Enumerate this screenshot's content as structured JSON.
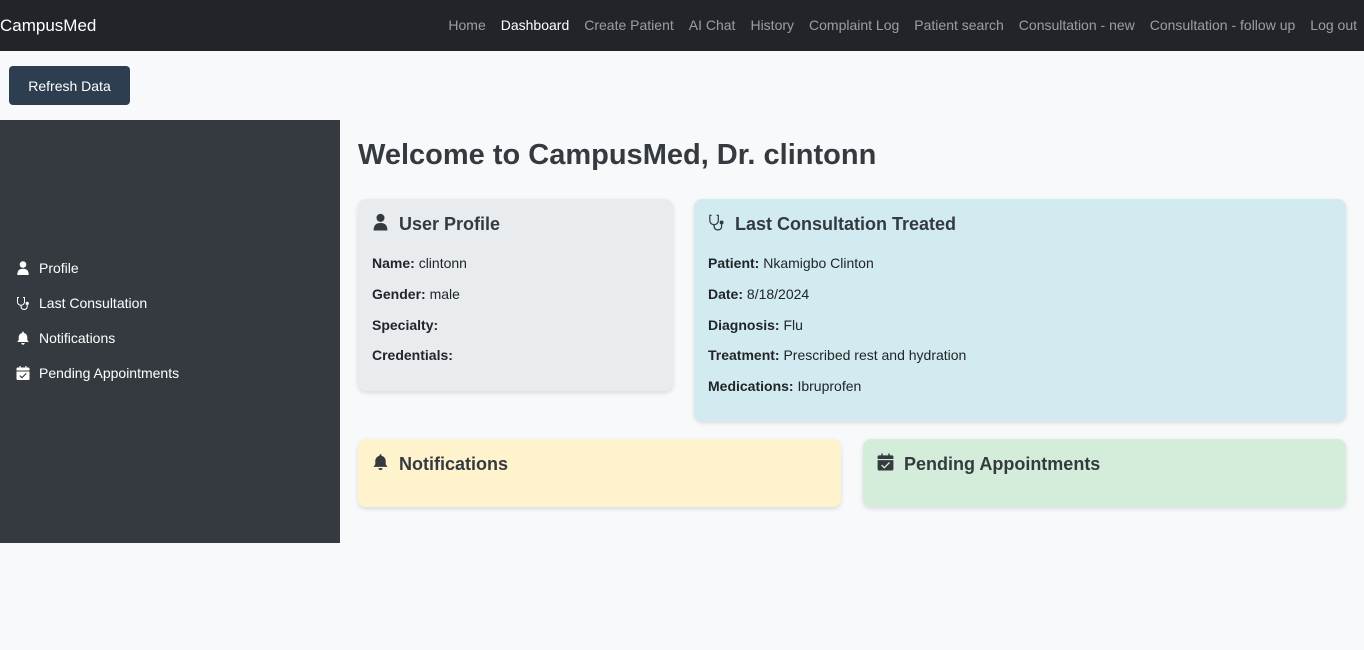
{
  "nav": {
    "brand": "CampusMed",
    "links": [
      "Home",
      "Dashboard",
      "Create Patient",
      "AI Chat",
      "History",
      "Complaint Log",
      "Patient search",
      "Consultation - new",
      "Consultation - follow up",
      "Log out"
    ]
  },
  "toolbar": {
    "refresh_label": "Refresh Data"
  },
  "sidebar": {
    "items": [
      {
        "label": "Profile",
        "icon": "user-icon"
      },
      {
        "label": "Last Consultation",
        "icon": "stethoscope-icon"
      },
      {
        "label": "Notifications",
        "icon": "bell-icon"
      },
      {
        "label": "Pending Appointments",
        "icon": "calendar-check-icon"
      }
    ]
  },
  "main": {
    "welcome": "Welcome to CampusMed, Dr. clintonn",
    "profile": {
      "title": "User Profile",
      "name_label": "Name:",
      "name": "clintonn",
      "gender_label": "Gender:",
      "gender": "male",
      "specialty_label": "Specialty:",
      "specialty": "",
      "credentials_label": "Credentials:",
      "credentials": ""
    },
    "consultation": {
      "title": "Last Consultation Treated",
      "patient_label": "Patient:",
      "patient": "Nkamigbo Clinton",
      "date_label": "Date:",
      "date": "8/18/2024",
      "diagnosis_label": "Diagnosis:",
      "diagnosis": "Flu",
      "treatment_label": "Treatment:",
      "treatment": "Prescribed rest and hydration",
      "medications_label": "Medications:",
      "medications": "Ibruprofen"
    },
    "notifications": {
      "title": "Notifications"
    },
    "appointments": {
      "title": "Pending Appointments"
    }
  },
  "colors": {
    "navbar": "#212529",
    "sidebar": "#343a40",
    "refresh_button": "#2c3e50",
    "profile_card": "#e8ecee",
    "consultation_card": "#d1ebf0",
    "notifications_card": "#fff3cd",
    "appointments_card": "#d4eddb"
  }
}
